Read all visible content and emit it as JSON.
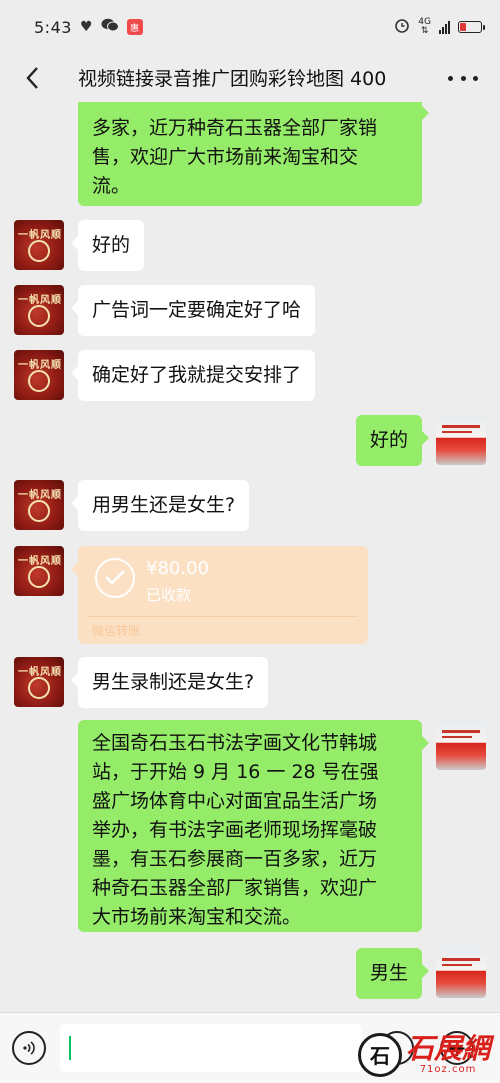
{
  "status_bar": {
    "time": "5:43",
    "left_icons": [
      "heart-icon",
      "wechat-icon",
      "app-badge-icon"
    ],
    "app_badge_text": "惠",
    "network": "4G",
    "battery_level": 0.3
  },
  "header": {
    "title": "视频链接录音推广团购彩铃地图 400",
    "back_icon": "back-arrow-icon",
    "more_icon": "more-dots-icon"
  },
  "messages": [
    {
      "side": "out",
      "type": "text",
      "text": "多家，近万种奇石玉器全部厂家销售，欢迎广大市场前来淘宝和交流。",
      "lines": [
        "多家，近万种奇石玉器全部厂家销",
        "售，欢迎广大市场前来淘宝和交",
        "流。"
      ]
    },
    {
      "side": "in",
      "type": "text",
      "text": "好的"
    },
    {
      "side": "in",
      "type": "text",
      "text": "广告词一定要确定好了哈"
    },
    {
      "side": "in",
      "type": "text",
      "text": "确定好了我就提交安排了"
    },
    {
      "side": "out",
      "type": "text",
      "text": "好的"
    },
    {
      "side": "in",
      "type": "text",
      "text": "用男生还是女生?"
    },
    {
      "side": "in",
      "type": "transfer",
      "amount": "¥80.00",
      "status": "已收款",
      "source": "微信转账"
    },
    {
      "side": "in",
      "type": "text",
      "text": "男生录制还是女生?"
    },
    {
      "side": "out",
      "type": "text",
      "text": "全国奇石玉石书法字画文化节韩城站，于开始 9 月 16 一 28 号在强盛广场体育中心对面宜品生活广场举办，有书法字画老师现场挥毫破墨，有玉石参展商一百多家，近万种奇石玉器全部厂家销售，欢迎广大市场前来淘宝和交流。",
      "lines": [
        "全国奇石玉石书法字画文化节韩城",
        "站，于开始 9 月 16 一 28 号在强",
        "盛广场体育中心对面宜品生活广场",
        "举办，有书法字画老师现场挥毫破",
        "墨，有玉石参展商一百多家，近万",
        "种奇石玉器全部厂家销售，欢迎广",
        "大市场前来淘宝和交流。"
      ]
    },
    {
      "side": "out",
      "type": "text",
      "text": "男生"
    }
  ],
  "input_bar": {
    "voice_icon": "voice-icon",
    "emoji_icon": "emoji-icon",
    "plus_icon": "plus-icon",
    "input_value": ""
  },
  "watermark": {
    "seal_text": "石",
    "text": "石展網",
    "url": "71oz.com"
  },
  "colors": {
    "background": "#ededed",
    "incoming_bubble": "#ffffff",
    "outgoing_bubble": "#95ec69",
    "transfer_card": "#fbe0c3",
    "watermark_red": "#d9201b"
  }
}
